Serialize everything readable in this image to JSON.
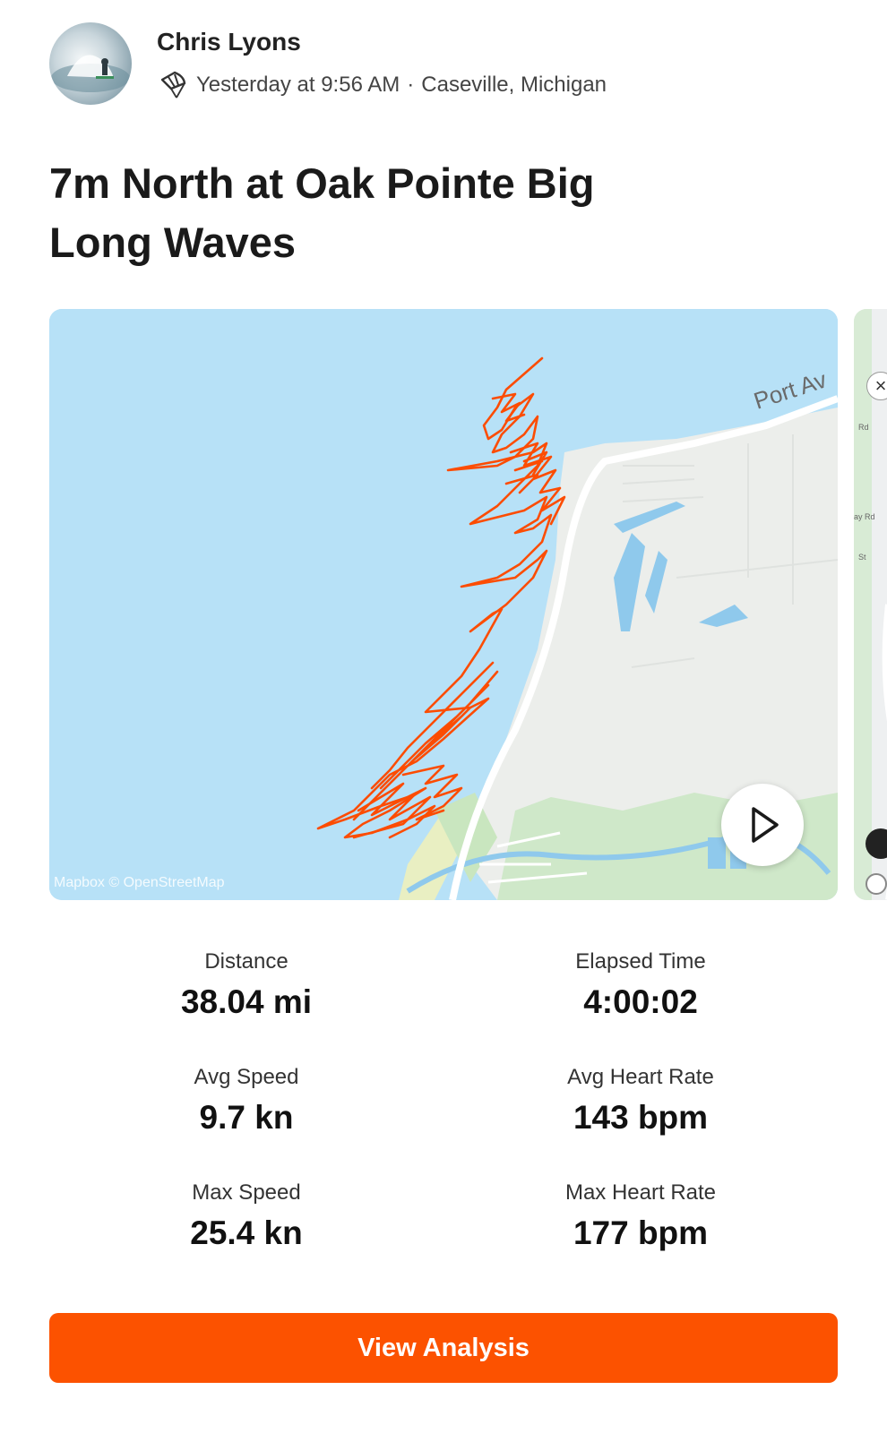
{
  "activity": {
    "athlete_name": "Chris Lyons",
    "timestamp": "Yesterday at 9:56 AM",
    "location": "Caseville, Michigan",
    "sport_icon": "kite-icon",
    "title": "7m North at Oak Pointe Big Long Waves"
  },
  "map": {
    "road_label": "Port Av",
    "attribution": "Mapbox © OpenStreetMap",
    "route_color": "#fc4c02",
    "water_color": "#b7e1f7",
    "land_color": "#eceeeb",
    "next_card_labels": [
      "Rd",
      "ay Rd",
      "St"
    ]
  },
  "stats": [
    {
      "label": "Distance",
      "value": "38.04 mi"
    },
    {
      "label": "Elapsed Time",
      "value": "4:00:02"
    },
    {
      "label": "Avg Speed",
      "value": "9.7 kn"
    },
    {
      "label": "Avg Heart Rate",
      "value": "143 bpm"
    },
    {
      "label": "Max Speed",
      "value": "25.4 kn"
    },
    {
      "label": "Max Heart Rate",
      "value": "177 bpm"
    }
  ],
  "cta": {
    "label": "View Analysis",
    "color": "#fc5200"
  }
}
